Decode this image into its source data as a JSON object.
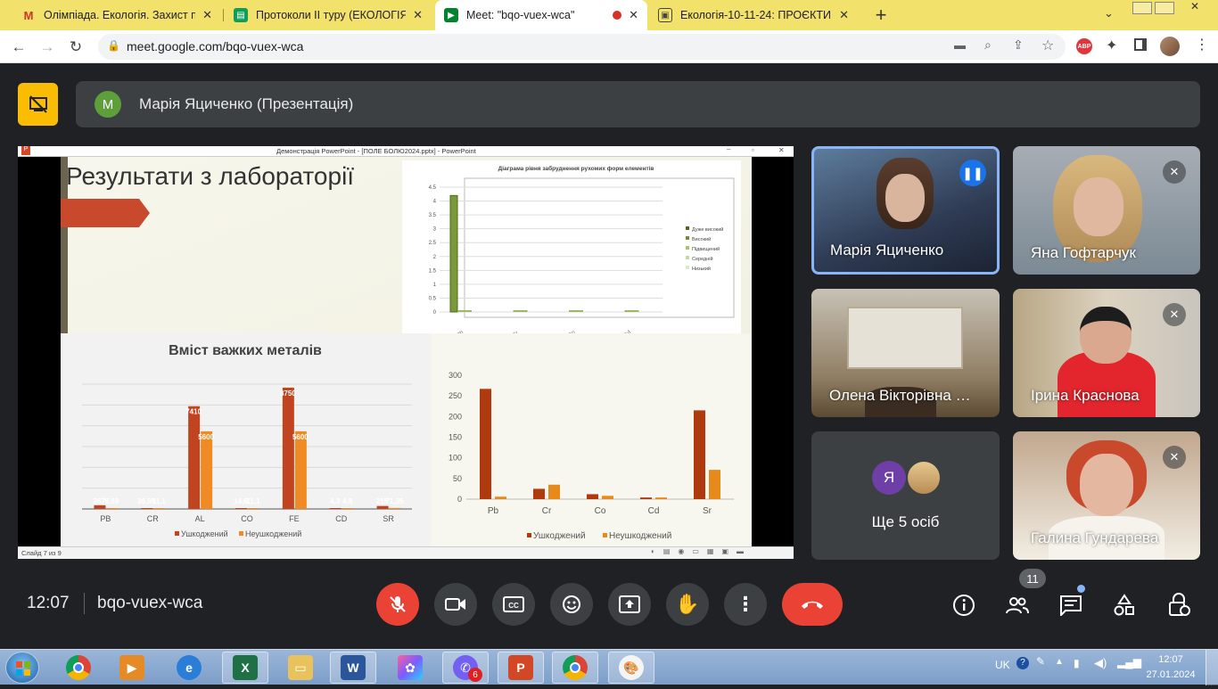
{
  "browser": {
    "tabs": [
      {
        "title": "Олімпіада. Екологія. Захист про…",
        "icon": "gmail-icon",
        "active": false
      },
      {
        "title": "Протоколи ІІ туру (ЕКОЛОГІЯ) 20…",
        "icon": "sheets-icon",
        "active": false
      },
      {
        "title": "Meet: \"bqo-vuex-wca\"",
        "icon": "meet-icon",
        "active": true
      },
      {
        "title": "Екологія-10-11-24: ПРОЄКТИ - …",
        "icon": "classroom-icon",
        "active": false
      }
    ],
    "url": "meet.google.com/bqo-vuex-wca"
  },
  "meet": {
    "presenter_initial": "M",
    "presenter_label": "Марія Яциченко (Презентація)",
    "time": "12:07",
    "meeting_code": "bqo-vuex-wca",
    "participant_count": "11",
    "others_label": "Ще 5 осіб",
    "others_initial": "Я",
    "participants": [
      {
        "name": "Марія Яциченко",
        "speaking": true
      },
      {
        "name": "Яна Гофтарчук",
        "muted": true
      },
      {
        "name": "Олена Вікторівна …"
      },
      {
        "name": "Ірина Краснова",
        "muted": true
      },
      {
        "name": "Галина Гундарева",
        "muted": true
      }
    ]
  },
  "slide": {
    "window_title": "Демонстрація PowerPoint - [ПОЛЕ БОЛЮ2024.pptx] - PowerPoint",
    "title": "Результати з лабораторії",
    "status": "Слайд 7 из 9",
    "chart1_title": "Діаграма рівня забруднення рухомих форм елементів",
    "chart2_title": "Вміст важких металів"
  },
  "chart_data": [
    {
      "type": "bar",
      "title": "Діаграма рівня забруднення рухомих форм елементів",
      "categories": [
        "Pb",
        "Cr",
        "Co",
        "Cd"
      ],
      "series": [
        {
          "name": "Дуже високий",
          "values": [
            0,
            0,
            0,
            0
          ]
        },
        {
          "name": "Високий",
          "values": [
            4.2,
            0,
            0,
            0
          ]
        },
        {
          "name": "Підвищений",
          "values": [
            0,
            0,
            0,
            0
          ]
        },
        {
          "name": "Середній",
          "values": [
            0,
            0,
            0,
            0
          ]
        },
        {
          "name": "Низький",
          "values": [
            0,
            0,
            0,
            0
          ]
        }
      ],
      "yticks": [
        "0",
        "0.5",
        "1",
        "1.5",
        "2",
        "2.5",
        "3",
        "3.5",
        "4",
        "4.5"
      ],
      "ylim": [
        0,
        4.5
      ]
    },
    {
      "type": "bar",
      "title": "Вміст важких металів",
      "categories": [
        "PB",
        "CR",
        "AL",
        "CO",
        "FE",
        "CD",
        "SR"
      ],
      "series": [
        {
          "name": "Ушкоджений",
          "values": [
            267,
            26.95,
            7410,
            14.6,
            8750,
            4.3,
            215
          ],
          "labels": [
            "267",
            "26,95",
            "7410",
            "14,6",
            "8750",
            "4,3",
            "215"
          ]
        },
        {
          "name": "Неушкоджений",
          "values": [
            8.69,
            11.1,
            5600,
            11.1,
            5600,
            4.8,
            71.35
          ],
          "labels": [
            "8,69",
            "11,1",
            "5600",
            "11,1",
            "5600",
            "4,8",
            "71,35"
          ]
        }
      ]
    },
    {
      "type": "bar",
      "categories": [
        "Pb",
        "Cr",
        "Co",
        "Cd",
        "Sr"
      ],
      "series": [
        {
          "name": "Ушкоджений",
          "values": [
            267,
            25,
            12,
            4,
            215
          ]
        },
        {
          "name": "Неушкоджений",
          "values": [
            6,
            35,
            8,
            4,
            71
          ]
        }
      ],
      "yticks": [
        "0",
        "50",
        "100",
        "150",
        "200",
        "250",
        "300"
      ],
      "ylim": [
        0,
        300
      ]
    }
  ],
  "taskbar": {
    "apps": [
      "chrome",
      "media",
      "ie",
      "excel",
      "explorer",
      "word",
      "paint-3d",
      "viber",
      "powerpoint",
      "chrome",
      "paint"
    ],
    "viber_badge": "6",
    "lang": "UK",
    "time": "12:07",
    "date": "27.01.2024"
  }
}
